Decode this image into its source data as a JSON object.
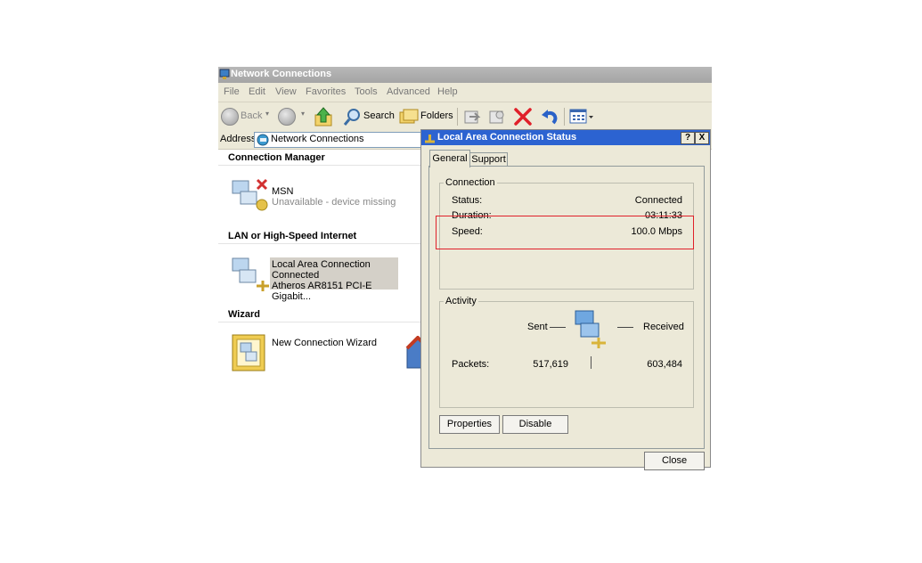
{
  "explorer": {
    "title": "Network Connections",
    "menu": [
      "File",
      "Edit",
      "View",
      "Favorites",
      "Tools",
      "Advanced",
      "Help"
    ],
    "toolbar": {
      "back_label": "Back",
      "search_label": "Search",
      "folders_label": "Folders"
    },
    "address": {
      "label": "Address",
      "value": "Network Connections"
    },
    "sections": {
      "connection_manager": {
        "heading": "Connection Manager",
        "item": {
          "name": "MSN",
          "status": "Unavailable - device missing"
        }
      },
      "lan": {
        "heading": "LAN or High-Speed Internet",
        "item": {
          "name": "Local Area Connection",
          "status": "Connected",
          "device": "Atheros AR8151 PCI-E Gigabit..."
        }
      },
      "wizard": {
        "heading": "Wizard",
        "item": {
          "name": "New Connection Wizard"
        }
      }
    }
  },
  "dialog": {
    "title": "Local Area Connection Status",
    "help_btn": "?",
    "close_btn": "X",
    "tabs": [
      "General",
      "Support"
    ],
    "connection": {
      "label": "Connection",
      "status_label": "Status:",
      "status_value": "Connected",
      "duration_label": "Duration:",
      "duration_value": "03:11:33",
      "speed_label": "Speed:",
      "speed_value": "100.0 Mbps"
    },
    "activity": {
      "label": "Activity",
      "sent_label": "Sent",
      "received_label": "Received",
      "packets_label": "Packets:",
      "packets_sent": "517,619",
      "packets_received": "603,484"
    },
    "buttons": {
      "properties": "Properties",
      "disable": "Disable",
      "close": "Close"
    }
  },
  "colors": {
    "dialog_title": "#2c63d1",
    "highlight": "#e0202a",
    "window_face": "#ece9d8"
  }
}
